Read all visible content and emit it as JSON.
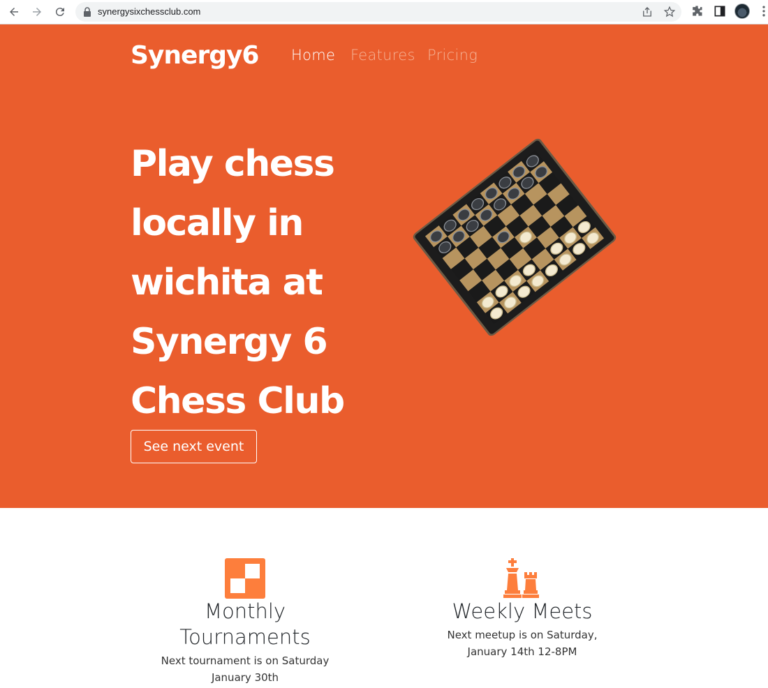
{
  "browser": {
    "url": "synergysixchessclub.com",
    "icons": [
      "back-icon",
      "forward-icon",
      "reload-icon",
      "lock-icon",
      "share-icon",
      "star-icon",
      "extensions-icon",
      "side-panel-icon",
      "profile-avatar",
      "menu-icon"
    ]
  },
  "nav": {
    "brand": "Synergy6",
    "links": [
      "Home",
      "Features",
      "Pricing"
    ]
  },
  "hero": {
    "headline_lines": [
      "Play chess",
      "locally in",
      "wichita at",
      "Synergy 6",
      "Chess Club"
    ],
    "cta_label": "See next event",
    "image": "chessboard-photo"
  },
  "features": [
    {
      "icon": "checkerboard-icon",
      "title": "Monthly Tournaments",
      "text": "Next tournament is on Saturday January 30th"
    },
    {
      "icon": "chess-pieces-icon",
      "title": "Weekly Meets",
      "text": "Next meetup is on Saturday, January 14th 12-8PM"
    }
  ],
  "colors": {
    "brand_orange": "#ea5d2d",
    "icon_orange": "#fd7e3c",
    "nav_inactive": "#f5b396"
  }
}
